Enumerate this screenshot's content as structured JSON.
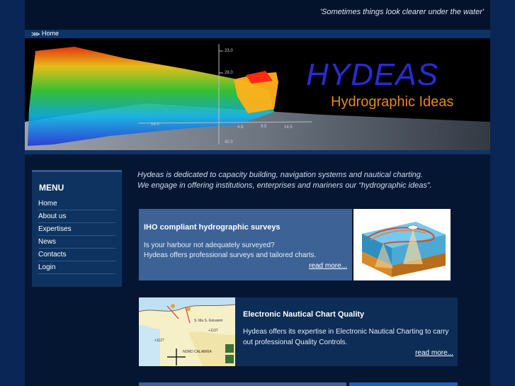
{
  "header": {
    "tagline": "'Sometimes things look clearer under the water'"
  },
  "breadcrumb": {
    "home": "Home"
  },
  "banner": {
    "brand": "HYDEAS",
    "subtitle": "Hydrographic Ideas",
    "scale_labels": [
      "23.0",
      "28.0",
      "14.0",
      "4.8",
      "9.5",
      "14.5",
      "42.0"
    ]
  },
  "menu": {
    "title": "MENU",
    "items": [
      "Home",
      "About us",
      "Expertises",
      "News",
      "Contacts",
      "Login"
    ]
  },
  "intro": {
    "line1": "Hydeas is dedicated to capacity building, navigation systems and nautical charting.",
    "line2": "We engage in offering institutions, enterprises and mariners our “hydrographic ideas”."
  },
  "cards": [
    {
      "title": "IHO compliant hydrographic surveys",
      "line1": "Is your harbour not adequately surveyed?",
      "line2": "Hydeas offers professional surveys and tailored charts.",
      "more": "read more..."
    },
    {
      "title": "Electronic Nautical Chart Quality",
      "line1": "Hydeas offers its expertise in Electronic Nautical Charting to carry",
      "line2": "out professional Quality Controls.",
      "more": "read more..."
    }
  ],
  "chart_labels": [
    "+1127",
    "+1137",
    "NORD CALABRIA",
    "S. Ma S. Giovanni"
  ],
  "colors": {
    "page_bg": "#061a3a",
    "side_bg": "#0a2657",
    "card_blue": "#3d6396",
    "card_dark": "#0d2d57",
    "brand_blue": "#2a2ad8",
    "brand_orange": "#e38a1e"
  }
}
